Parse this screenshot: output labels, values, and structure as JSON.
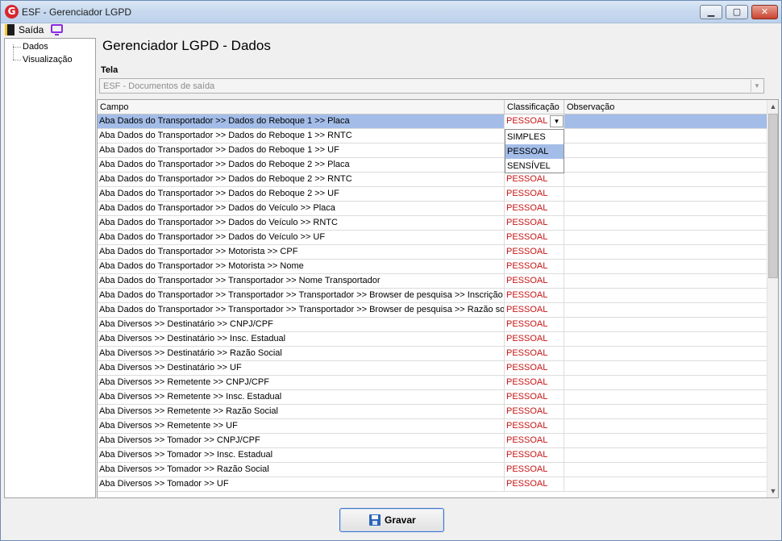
{
  "window": {
    "title": "ESF - Gerenciador LGPD",
    "logo_letter": "G",
    "controls": {
      "minimize": "▁",
      "maximize": "▢",
      "close": "✕"
    }
  },
  "menubar": {
    "exit_label": "Saída"
  },
  "tree": {
    "items": [
      {
        "label": "Dados"
      },
      {
        "label": "Visualização"
      }
    ]
  },
  "main": {
    "title": "Gerenciador LGPD - Dados"
  },
  "tela": {
    "label": "Tela",
    "value": "ESF - Documentos de saída"
  },
  "grid": {
    "columns": {
      "campo": "Campo",
      "classificacao": "Classificação",
      "observacao": "Observação"
    },
    "selected_row": 0,
    "rows": [
      {
        "campo": "Aba Dados do Transportador >> Dados do Reboque 1 >> Placa",
        "classificacao": "PESSOAL",
        "observacao": ""
      },
      {
        "campo": "Aba Dados do Transportador >> Dados do Reboque 1 >> RNTC",
        "classificacao": "",
        "observacao": ""
      },
      {
        "campo": "Aba Dados do Transportador >> Dados do Reboque 1 >> UF",
        "classificacao": "",
        "observacao": ""
      },
      {
        "campo": "Aba Dados do Transportador >> Dados do Reboque 2 >> Placa",
        "classificacao": "",
        "observacao": ""
      },
      {
        "campo": "Aba Dados do Transportador >> Dados do Reboque 2 >> RNTC",
        "classificacao": "PESSOAL",
        "observacao": ""
      },
      {
        "campo": "Aba Dados do Transportador >> Dados do Reboque 2 >> UF",
        "classificacao": "PESSOAL",
        "observacao": ""
      },
      {
        "campo": "Aba Dados do Transportador >> Dados do Veículo >> Placa",
        "classificacao": "PESSOAL",
        "observacao": ""
      },
      {
        "campo": "Aba Dados do Transportador >> Dados do Veículo >> RNTC",
        "classificacao": "PESSOAL",
        "observacao": ""
      },
      {
        "campo": "Aba Dados do Transportador >> Dados do Veículo >> UF",
        "classificacao": "PESSOAL",
        "observacao": ""
      },
      {
        "campo": "Aba Dados do Transportador >> Motorista >> CPF",
        "classificacao": "PESSOAL",
        "observacao": ""
      },
      {
        "campo": "Aba Dados do Transportador >> Motorista >> Nome",
        "classificacao": "PESSOAL",
        "observacao": ""
      },
      {
        "campo": "Aba Dados do Transportador >> Transportador >> Nome Transportador",
        "classificacao": "PESSOAL",
        "observacao": ""
      },
      {
        "campo": "Aba Dados do Transportador >> Transportador >> Transportador  >> Browser de pesquisa >> Inscrição",
        "classificacao": "PESSOAL",
        "observacao": ""
      },
      {
        "campo": "Aba Dados do Transportador >> Transportador >> Transportador  >> Browser de pesquisa >> Razão soc...",
        "classificacao": "PESSOAL",
        "observacao": ""
      },
      {
        "campo": "Aba Diversos >> Destinatário >> CNPJ/CPF",
        "classificacao": "PESSOAL",
        "observacao": ""
      },
      {
        "campo": "Aba Diversos >> Destinatário >> Insc. Estadual",
        "classificacao": "PESSOAL",
        "observacao": ""
      },
      {
        "campo": "Aba Diversos >> Destinatário >> Razão Social",
        "classificacao": "PESSOAL",
        "observacao": ""
      },
      {
        "campo": "Aba Diversos >> Destinatário >> UF",
        "classificacao": "PESSOAL",
        "observacao": ""
      },
      {
        "campo": "Aba Diversos >> Remetente >> CNPJ/CPF",
        "classificacao": "PESSOAL",
        "observacao": ""
      },
      {
        "campo": "Aba Diversos >> Remetente >> Insc. Estadual",
        "classificacao": "PESSOAL",
        "observacao": ""
      },
      {
        "campo": "Aba Diversos >> Remetente >> Razão Social",
        "classificacao": "PESSOAL",
        "observacao": ""
      },
      {
        "campo": "Aba Diversos >> Remetente >> UF",
        "classificacao": "PESSOAL",
        "observacao": ""
      },
      {
        "campo": "Aba Diversos >> Tomador >> CNPJ/CPF",
        "classificacao": "PESSOAL",
        "observacao": ""
      },
      {
        "campo": "Aba Diversos >> Tomador >> Insc. Estadual",
        "classificacao": "PESSOAL",
        "observacao": ""
      },
      {
        "campo": "Aba Diversos >> Tomador >> Razão Social",
        "classificacao": "PESSOAL",
        "observacao": ""
      },
      {
        "campo": "Aba Diversos >> Tomador >> UF",
        "classificacao": "PESSOAL",
        "observacao": ""
      }
    ],
    "dropdown": {
      "options": [
        "SIMPLES",
        "PESSOAL",
        "SENSÍVEL"
      ],
      "highlighted": 1
    }
  },
  "footer": {
    "save_label": "Gravar"
  },
  "colors": {
    "selection": "#a3bde8",
    "classification_text": "#c81414",
    "close_button": "#c9432f"
  }
}
